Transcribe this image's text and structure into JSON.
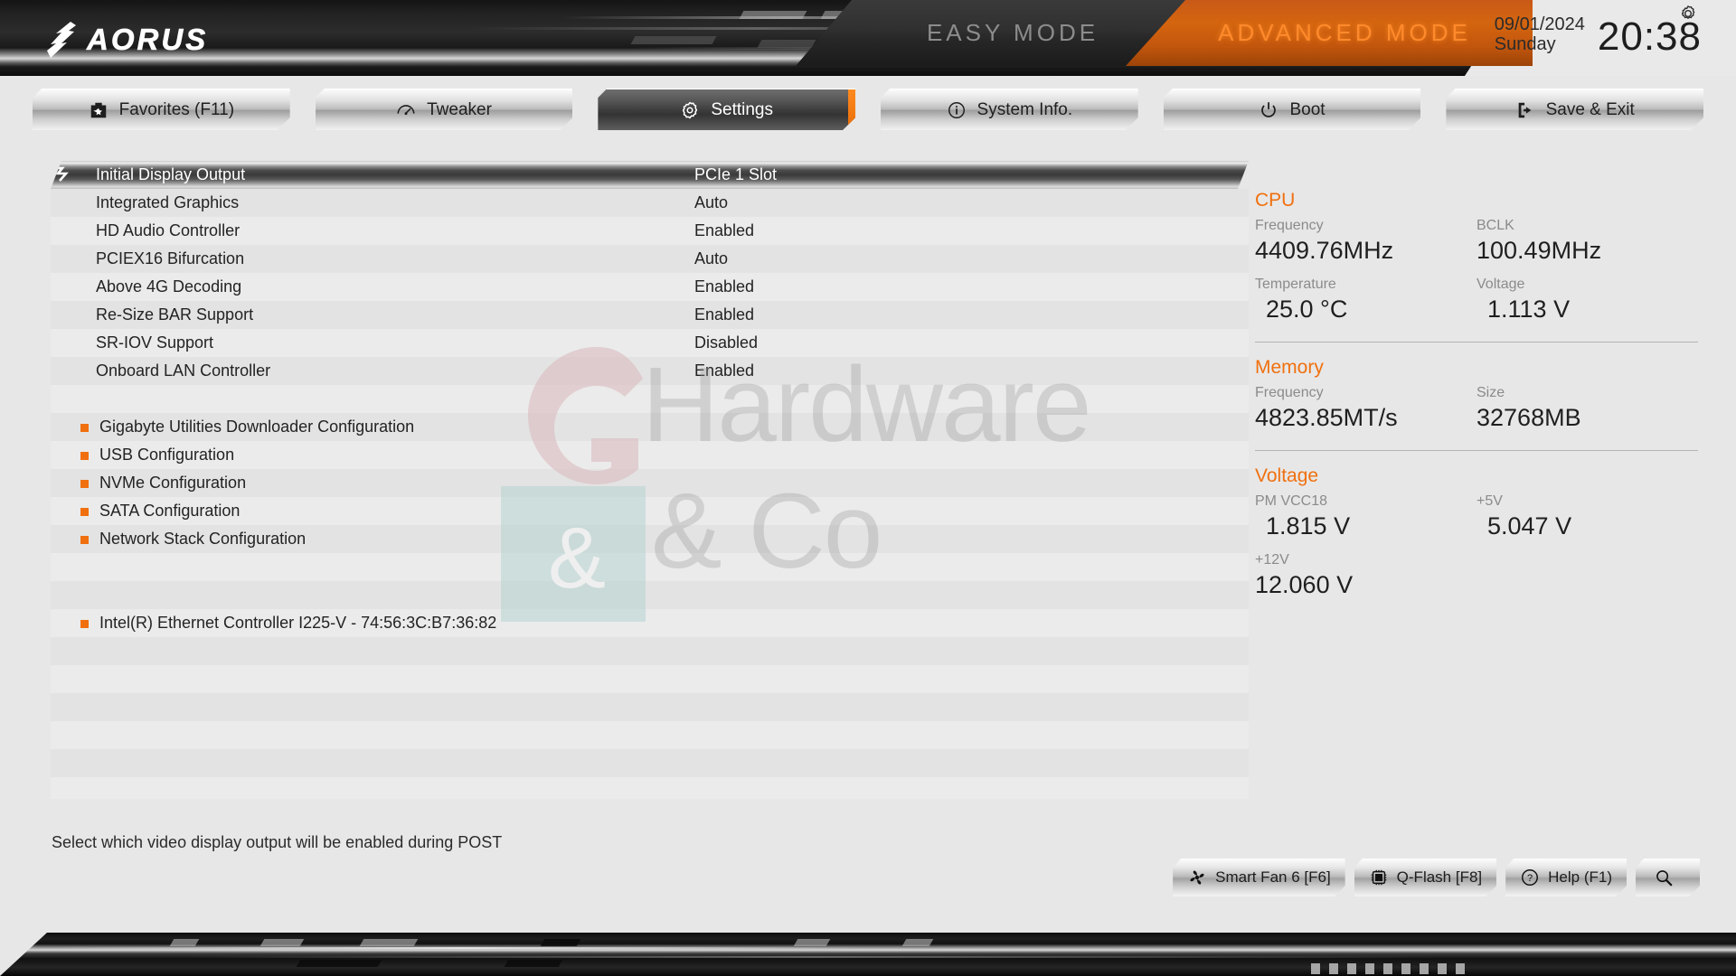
{
  "header": {
    "brand": "AORUS",
    "easy_mode_label": "EASY MODE",
    "advanced_mode_label": "ADVANCED MODE",
    "date": "09/01/2024",
    "weekday": "Sunday",
    "time": "20:38",
    "accent_color": "#f0700f",
    "settings_gear_icon": "gear-icon"
  },
  "tabs": [
    {
      "label": "Favorites (F11)",
      "icon": "star-box-icon",
      "active": false
    },
    {
      "label": "Tweaker",
      "icon": "gauge-icon",
      "active": false
    },
    {
      "label": "Settings",
      "icon": "gear-icon",
      "active": true
    },
    {
      "label": "System Info.",
      "icon": "info-icon",
      "active": false
    },
    {
      "label": "Boot",
      "icon": "power-icon",
      "active": false
    },
    {
      "label": "Save & Exit",
      "icon": "exit-icon",
      "active": false
    }
  ],
  "settings_list": [
    {
      "label": "Initial Display Output",
      "value": "PCIe 1 Slot",
      "selected": true,
      "submenu": false
    },
    {
      "label": "Integrated Graphics",
      "value": "Auto",
      "selected": false,
      "submenu": false
    },
    {
      "label": "HD Audio Controller",
      "value": "Enabled",
      "selected": false,
      "submenu": false
    },
    {
      "label": "PCIEX16 Bifurcation",
      "value": "Auto",
      "selected": false,
      "submenu": false
    },
    {
      "label": "Above 4G Decoding",
      "value": "Enabled",
      "selected": false,
      "submenu": false
    },
    {
      "label": "Re-Size BAR Support",
      "value": "Enabled",
      "selected": false,
      "submenu": false
    },
    {
      "label": "SR-IOV Support",
      "value": "Disabled",
      "selected": false,
      "submenu": false
    },
    {
      "label": "Onboard LAN Controller",
      "value": "Enabled",
      "selected": false,
      "submenu": false
    },
    {
      "label": "",
      "value": "",
      "selected": false,
      "submenu": false
    },
    {
      "label": "Gigabyte Utilities Downloader Configuration",
      "value": "",
      "selected": false,
      "submenu": true
    },
    {
      "label": "USB Configuration",
      "value": "",
      "selected": false,
      "submenu": true
    },
    {
      "label": "NVMe Configuration",
      "value": "",
      "selected": false,
      "submenu": true
    },
    {
      "label": "SATA Configuration",
      "value": "",
      "selected": false,
      "submenu": true
    },
    {
      "label": "Network Stack Configuration",
      "value": "",
      "selected": false,
      "submenu": true
    },
    {
      "label": "",
      "value": "",
      "selected": false,
      "submenu": false
    },
    {
      "label": "",
      "value": "",
      "selected": false,
      "submenu": false
    },
    {
      "label": "Intel(R) Ethernet Controller I225-V - 74:56:3C:B7:36:82",
      "value": "",
      "selected": false,
      "submenu": true
    },
    {
      "label": "",
      "value": "",
      "selected": false,
      "submenu": false
    },
    {
      "label": "",
      "value": "",
      "selected": false,
      "submenu": false
    },
    {
      "label": "",
      "value": "",
      "selected": false,
      "submenu": false
    },
    {
      "label": "",
      "value": "",
      "selected": false,
      "submenu": false
    },
    {
      "label": "",
      "value": "",
      "selected": false,
      "submenu": false
    },
    {
      "label": "",
      "value": "",
      "selected": false,
      "submenu": false
    }
  ],
  "info": {
    "cpu": {
      "title": "CPU",
      "frequency_label": "Frequency",
      "frequency_value": "4409.76MHz",
      "bclk_label": "BCLK",
      "bclk_value": "100.49MHz",
      "temperature_label": "Temperature",
      "temperature_value": "25.0 °C",
      "voltage_label": "Voltage",
      "voltage_value": "1.113 V"
    },
    "memory": {
      "title": "Memory",
      "frequency_label": "Frequency",
      "frequency_value": "4823.85MT/s",
      "size_label": "Size",
      "size_value": "32768MB"
    },
    "voltage": {
      "title": "Voltage",
      "pm_vcc18_label": "PM VCC18",
      "pm_vcc18_value": "1.815 V",
      "p5v_label": "+5V",
      "p5v_value": "5.047 V",
      "p12v_label": "+12V",
      "p12v_value": "12.060 V"
    }
  },
  "hint": "Select which video display output will be enabled during POST",
  "bottom_buttons": [
    {
      "label": "Smart Fan 6 [F6]",
      "icon": "fan-icon"
    },
    {
      "label": "Q-Flash [F8]",
      "icon": "chip-icon"
    },
    {
      "label": "Help (F1)",
      "icon": "question-circle-icon"
    },
    {
      "label": "",
      "icon": "search-icon"
    }
  ],
  "watermark": {
    "line1": "Hardware",
    "line2": "& Co"
  }
}
